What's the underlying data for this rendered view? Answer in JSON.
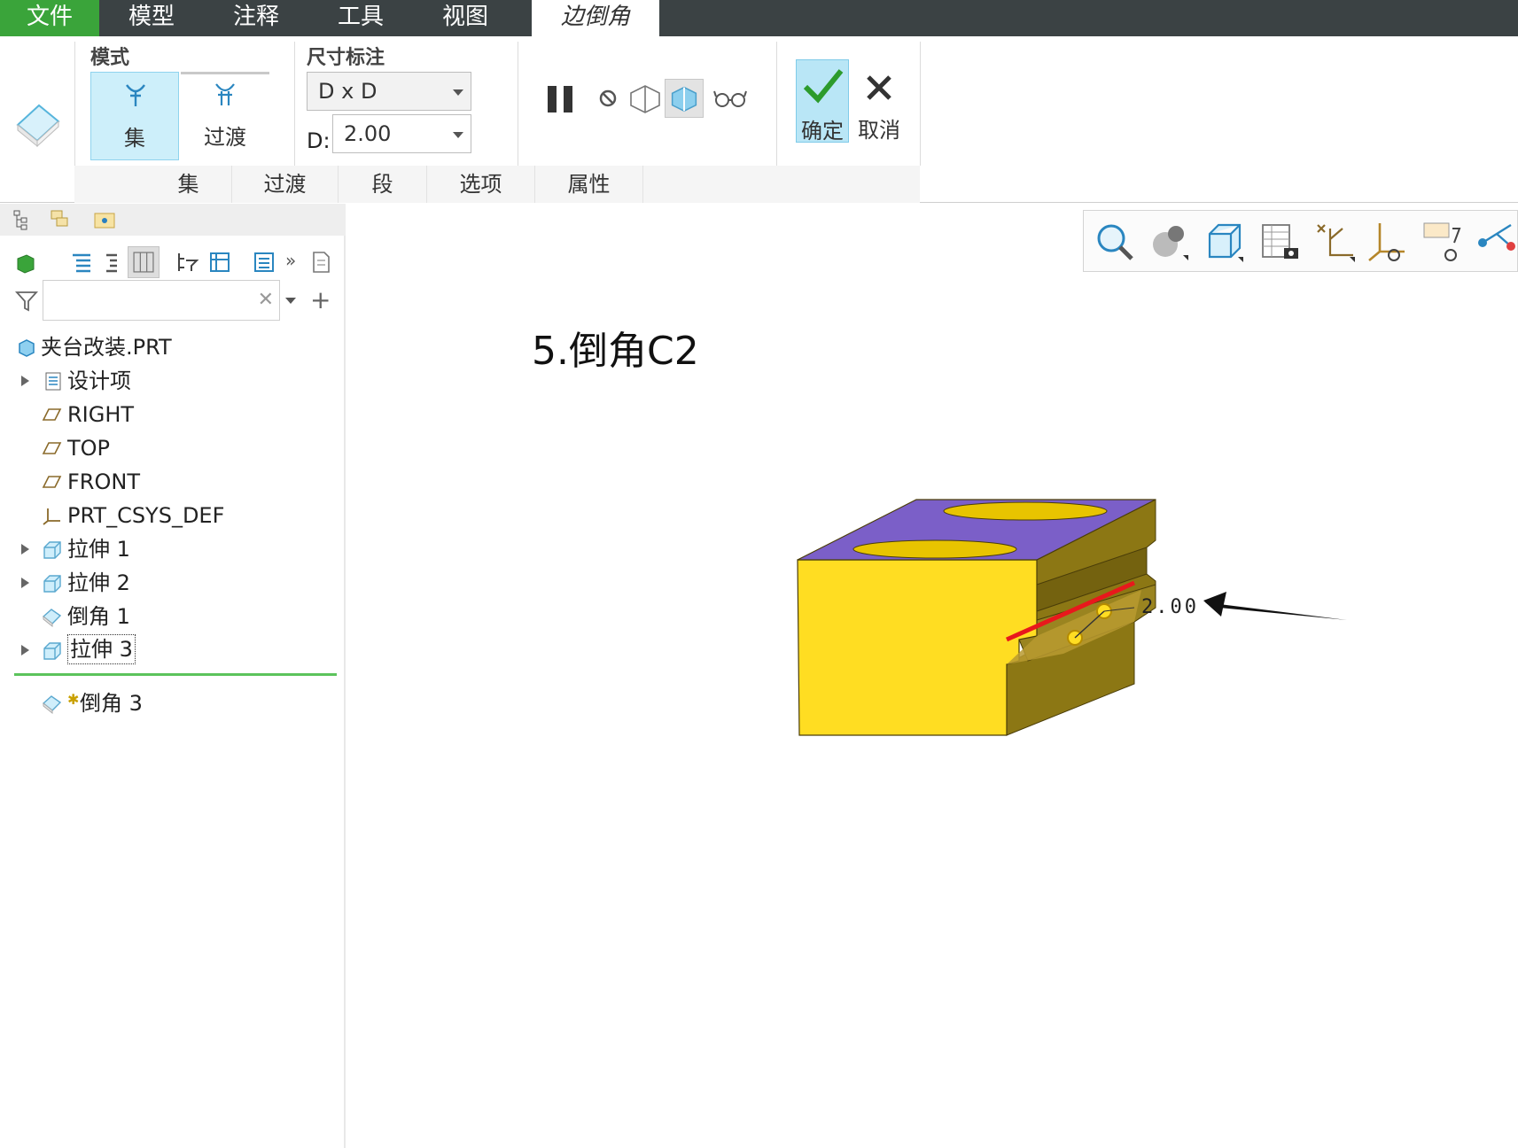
{
  "menu": {
    "file": "文件",
    "model": "模型",
    "annotate": "注释",
    "tools": "工具",
    "view": "视图",
    "edge_chamfer": "边倒角"
  },
  "ribbon": {
    "mode_group_label": "模式",
    "mode_set": "集",
    "mode_transition": "过渡",
    "dimension_group_label": "尺寸标注",
    "dimension_scheme": "D x D",
    "d_label": "D:",
    "d_value": "2.00",
    "ok_label": "确定",
    "cancel_label": "取消",
    "subtabs": [
      "集",
      "过渡",
      "段",
      "选项",
      "属性"
    ]
  },
  "model_tree": {
    "search_placeholder": "",
    "items": [
      {
        "label": "夹台改装.PRT",
        "icon": "part-icon"
      },
      {
        "label": "设计项",
        "icon": "design-items-icon"
      },
      {
        "label": "RIGHT",
        "icon": "datum-plane-icon"
      },
      {
        "label": "TOP",
        "icon": "datum-plane-icon"
      },
      {
        "label": "FRONT",
        "icon": "datum-plane-icon"
      },
      {
        "label": "PRT_CSYS_DEF",
        "icon": "csys-icon"
      },
      {
        "label": "拉伸 1",
        "icon": "extrude-icon"
      },
      {
        "label": "拉伸 2",
        "icon": "extrude-icon"
      },
      {
        "label": "倒角 1",
        "icon": "chamfer-icon"
      },
      {
        "label": "拉伸 3",
        "icon": "extrude-icon"
      },
      {
        "label": "倒角 3",
        "icon": "chamfer-icon"
      }
    ]
  },
  "graphics": {
    "step_title": "5.倒角C2",
    "dimension_annotation": "2.00"
  },
  "colors": {
    "accent_green": "#3aa43a",
    "menubar": "#3b4244",
    "selected_blue": "#cdeffa",
    "part_yellow": "#ffdd22",
    "part_top_purple": "#7b5fc8",
    "edge_highlight_red": "#e8181c"
  }
}
